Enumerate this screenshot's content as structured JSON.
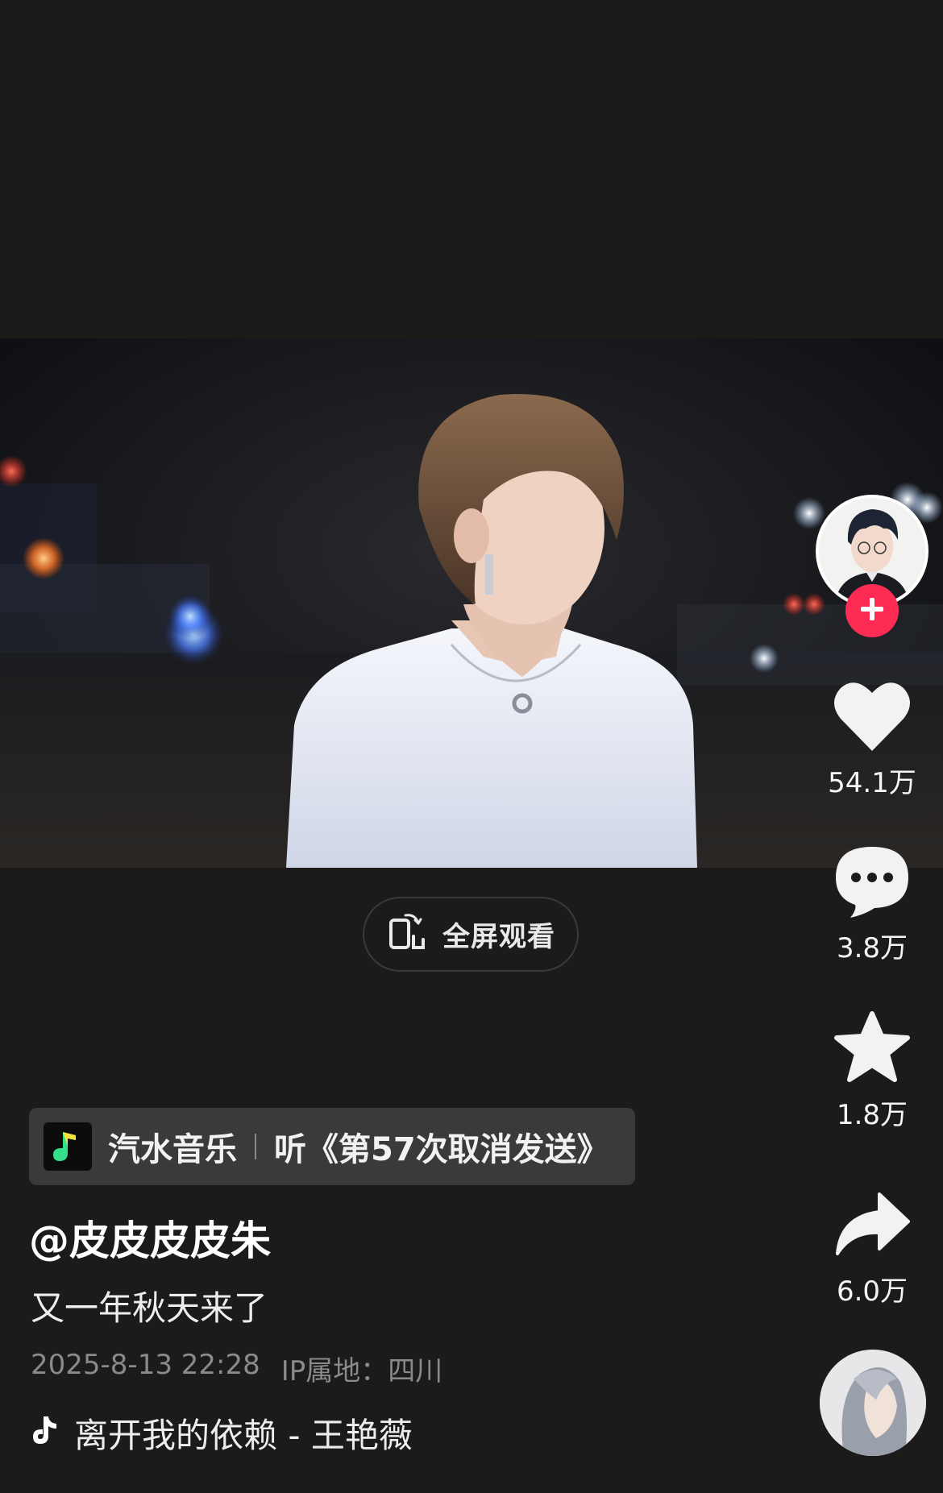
{
  "fullscreen": {
    "label": "全屏观看"
  },
  "music": {
    "app": "汽水音乐",
    "song": "听《第57次取消发送》"
  },
  "post": {
    "author": "@皮皮皮皮朱",
    "caption": "又一年秋天来了",
    "datetime": "2025-8-13 22:28",
    "ip_location": "IP属地：四川",
    "bgm": "离开我的依赖 - 王艳薇"
  },
  "actions": {
    "like_count": "54.1万",
    "comment_count": "3.8万",
    "favorite_count": "1.8万",
    "share_count": "6.0万"
  },
  "icons": [
    "heart-icon",
    "comment-icon",
    "star-icon",
    "share-icon",
    "tiktok-note-icon",
    "fullscreen-rotate-icon",
    "plus-icon"
  ],
  "colors": {
    "background": "#1c1b1a",
    "follow_badge": "#fe2c55",
    "music_tag": "#3b3a39"
  }
}
